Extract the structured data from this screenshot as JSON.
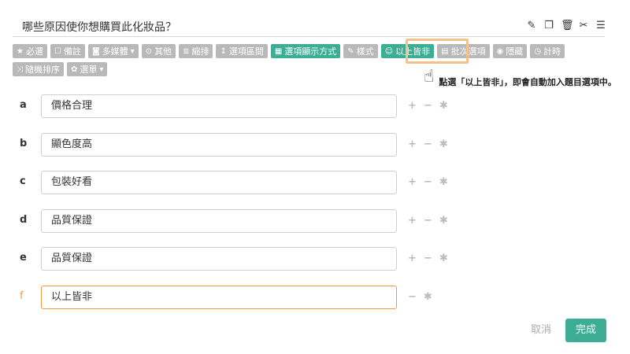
{
  "question": {
    "title": "哪些原因使你想購買此化妝品？"
  },
  "top_icons": [
    "edit-icon",
    "copy-icon",
    "trash-icon",
    "scissors-icon",
    "menu-icon"
  ],
  "toolbar": {
    "row1": [
      {
        "label": "必選",
        "glyph": "★",
        "icon": "star-icon",
        "style": "gray"
      },
      {
        "label": "備註",
        "glyph": "☐",
        "icon": "comment-icon",
        "style": "gray"
      },
      {
        "label": "多媒體",
        "glyph": "◙",
        "icon": "camera-icon",
        "style": "gray",
        "caret": "▾"
      },
      {
        "label": "其他",
        "glyph": "⊙",
        "icon": "other-icon",
        "style": "gray"
      },
      {
        "label": "縮排",
        "glyph": "≣",
        "icon": "indent-icon",
        "style": "gray"
      },
      {
        "label": "選項區間",
        "glyph": "↕",
        "icon": "range-icon",
        "style": "gray"
      },
      {
        "label": "選項顯示方式",
        "glyph": "▦",
        "icon": "grid-icon",
        "style": "green"
      },
      {
        "label": "樣式",
        "glyph": "✎",
        "icon": "brush-icon",
        "style": "gray"
      },
      {
        "label": "以上皆非",
        "glyph": "☺",
        "icon": "none-of-above-icon",
        "style": "green"
      },
      {
        "label": "批次選項",
        "glyph": "▤",
        "icon": "batch-icon",
        "style": "gray"
      },
      {
        "label": "隱藏",
        "glyph": "◉",
        "icon": "eye-slash-icon",
        "style": "gray"
      },
      {
        "label": "計時",
        "glyph": "◷",
        "icon": "clock-icon",
        "style": "gray"
      }
    ],
    "row2": [
      {
        "label": "隨機排序",
        "glyph": "⤨",
        "icon": "shuffle-icon",
        "style": "gray"
      },
      {
        "label": "選單",
        "glyph": "✿",
        "icon": "gear-icon",
        "style": "gray",
        "caret": "▾"
      }
    ]
  },
  "hint": {
    "text": "點選「以上皆非」，即會自動加入題目選項中。",
    "icon": "pointing-hand-icon"
  },
  "options": [
    {
      "letter": "a",
      "value": "價格合理",
      "active": false
    },
    {
      "letter": "b",
      "value": "顯色度高",
      "active": false
    },
    {
      "letter": "c",
      "value": "包裝好看",
      "active": false
    },
    {
      "letter": "d",
      "value": "品質保證",
      "active": false
    },
    {
      "letter": "e",
      "value": "品質保證",
      "active": false
    },
    {
      "letter": "f",
      "value": "以上皆非",
      "active": true
    }
  ],
  "footer": {
    "cancel_label": "取消",
    "done_label": "完成"
  },
  "colors": {
    "accent": "#3bae94",
    "active_option": "#f39a3d",
    "highlight": "#f2c28a",
    "toolbar_gray": "#b9b9b9"
  }
}
